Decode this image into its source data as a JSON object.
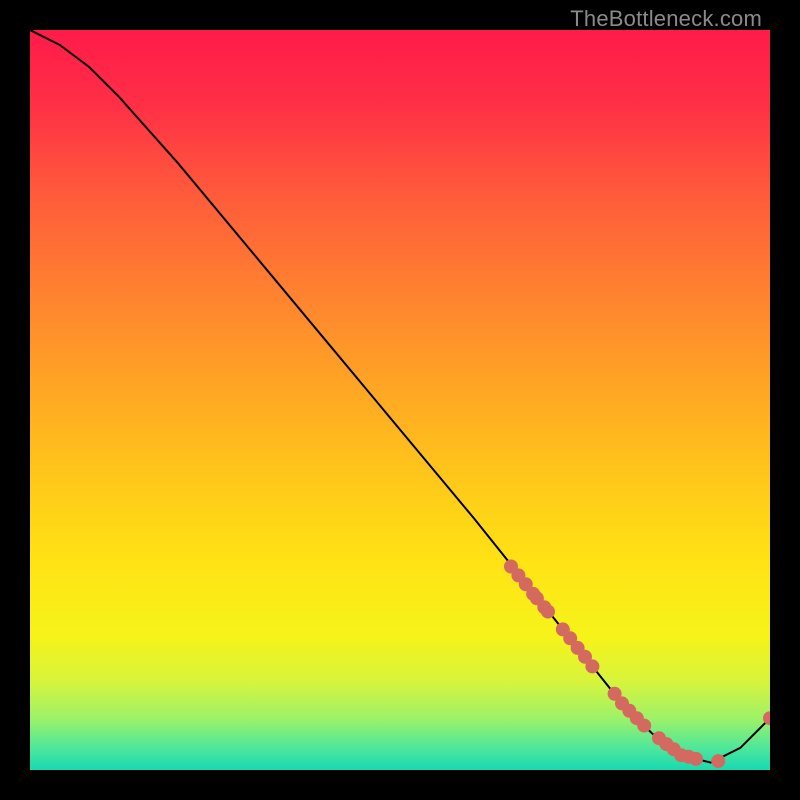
{
  "watermark": "TheBottleneck.com",
  "chart_data": {
    "type": "line",
    "title": "",
    "xlabel": "",
    "ylabel": "",
    "xlim": [
      0,
      100
    ],
    "ylim": [
      0,
      100
    ],
    "grid": false,
    "series": [
      {
        "name": "curve",
        "x": [
          0,
          4,
          8,
          12,
          20,
          30,
          40,
          50,
          60,
          68,
          72,
          76,
          80,
          84,
          88,
          92,
          96,
          100
        ],
        "y": [
          100,
          98,
          95,
          91,
          82,
          70,
          58,
          46,
          34,
          24,
          19,
          14,
          9,
          5,
          2,
          1,
          3,
          7
        ]
      }
    ],
    "markers": {
      "name": "dots",
      "color": "#d46a5f",
      "points_x": [
        65,
        66,
        67,
        68,
        68.5,
        69.5,
        70,
        72,
        73,
        74,
        75,
        76,
        79,
        80,
        81,
        82,
        83,
        85,
        86,
        87,
        88,
        89,
        90,
        93,
        100
      ],
      "points_y": [
        27.5,
        26.3,
        25.1,
        23.8,
        23.2,
        22.0,
        21.4,
        19.0,
        17.8,
        16.5,
        15.3,
        14.0,
        10.3,
        9.0,
        8.0,
        7.0,
        6.0,
        4.3,
        3.5,
        2.8,
        2.0,
        1.8,
        1.5,
        1.2,
        7.0
      ]
    },
    "gradient_stops": [
      {
        "offset": 0.0,
        "color": "#ff1b4a"
      },
      {
        "offset": 0.1,
        "color": "#ff2f46"
      },
      {
        "offset": 0.22,
        "color": "#ff5a3b"
      },
      {
        "offset": 0.35,
        "color": "#ff8030"
      },
      {
        "offset": 0.48,
        "color": "#ffa524"
      },
      {
        "offset": 0.6,
        "color": "#ffc61a"
      },
      {
        "offset": 0.72,
        "color": "#ffe314"
      },
      {
        "offset": 0.82,
        "color": "#f6f31a"
      },
      {
        "offset": 0.88,
        "color": "#d7f43b"
      },
      {
        "offset": 0.93,
        "color": "#9ef268"
      },
      {
        "offset": 0.97,
        "color": "#4fe79a"
      },
      {
        "offset": 1.0,
        "color": "#17d9b2"
      }
    ]
  }
}
